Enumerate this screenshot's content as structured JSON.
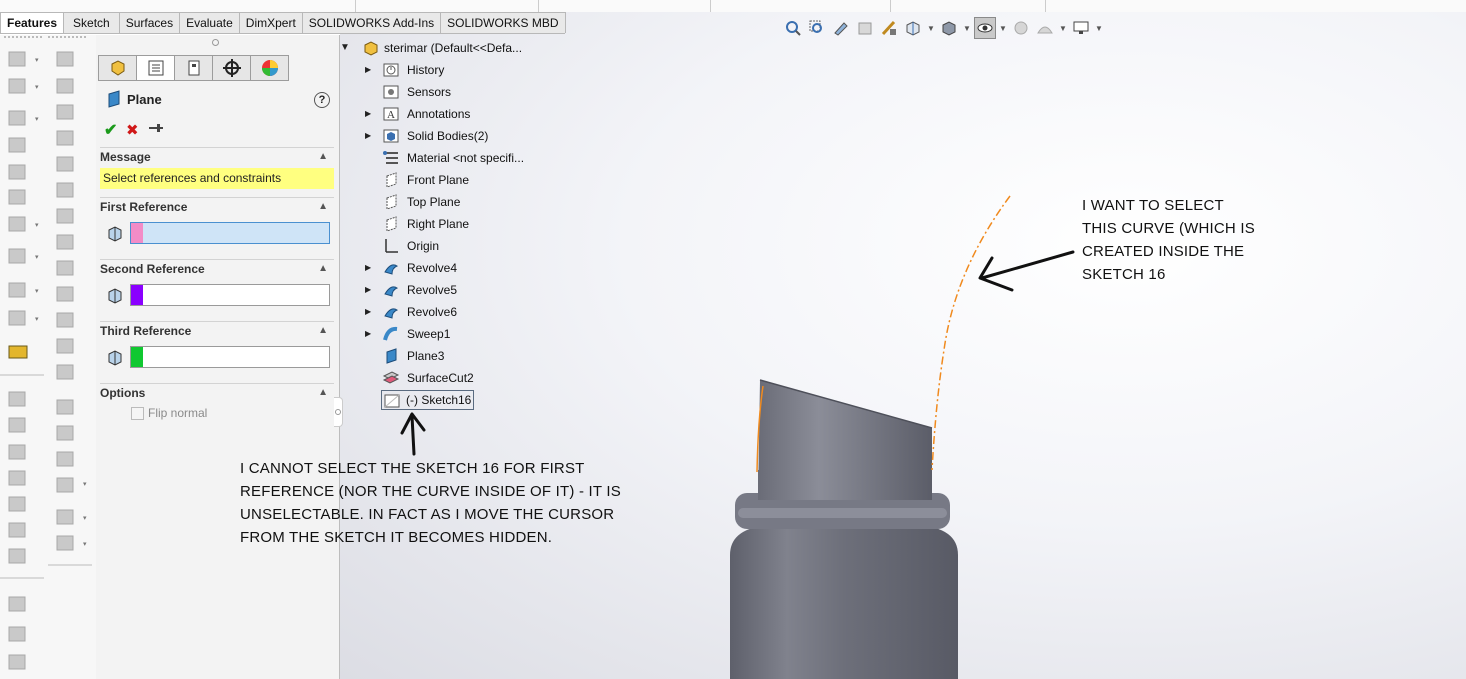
{
  "command_tabs": [
    "Features",
    "Sketch",
    "Surfaces",
    "Evaluate",
    "DimXpert",
    "SOLIDWORKS Add-Ins",
    "SOLIDWORKS MBD"
  ],
  "property_manager": {
    "title": "Plane",
    "help_icon": "?",
    "ok_icon": "✔",
    "cancel_icon": "✖",
    "pin_icon": "pin-icon",
    "message_header": "Message",
    "message_text": "Select references and constraints",
    "first_reference_header": "First Reference",
    "second_reference_header": "Second Reference",
    "third_reference_header": "Third Reference",
    "options_header": "Options",
    "flip_normal_label": "Flip normal",
    "colors": {
      "first": "#f38cc7",
      "second": "#8a00ff",
      "third": "#10c830",
      "message_bg": "#ffff80",
      "first_field_bg": "#cfe4f7"
    }
  },
  "feature_tree": {
    "root": "sterimar  (Default<<Defa...",
    "items": [
      {
        "label": "History",
        "icon": "history-icon",
        "expandable": true
      },
      {
        "label": "Sensors",
        "icon": "sensor-icon",
        "expandable": false
      },
      {
        "label": "Annotations",
        "icon": "annotation-icon",
        "expandable": true
      },
      {
        "label": "Solid Bodies(2)",
        "icon": "solid-bodies-icon",
        "expandable": true
      },
      {
        "label": "Material <not specifi...",
        "icon": "material-icon",
        "expandable": false
      },
      {
        "label": "Front Plane",
        "icon": "plane-icon",
        "expandable": false
      },
      {
        "label": "Top Plane",
        "icon": "plane-icon",
        "expandable": false
      },
      {
        "label": "Right Plane",
        "icon": "plane-icon",
        "expandable": false
      },
      {
        "label": "Origin",
        "icon": "origin-icon",
        "expandable": false
      },
      {
        "label": "Revolve4",
        "icon": "revolve-icon",
        "expandable": true
      },
      {
        "label": "Revolve5",
        "icon": "revolve-icon",
        "expandable": true
      },
      {
        "label": "Revolve6",
        "icon": "revolve-icon",
        "expandable": true
      },
      {
        "label": "Sweep1",
        "icon": "sweep-icon",
        "expandable": true
      },
      {
        "label": "Plane3",
        "icon": "plane3-icon",
        "expandable": false
      },
      {
        "label": "SurfaceCut2",
        "icon": "surface-cut-icon",
        "expandable": false
      },
      {
        "label": "(-) Sketch16",
        "icon": "sketch-icon",
        "expandable": false
      }
    ]
  },
  "annotations": {
    "left_note": [
      "I CANNOT SELECT THE SKETCH 16 FOR FIRST",
      "REFERENCE (NOR THE CURVE INSIDE OF IT) - IT IS",
      "UNSELECTABLE. IN FACT AS I MOVE THE CURSOR",
      "FROM THE SKETCH IT BECOMES HIDDEN."
    ],
    "right_note": [
      "I WANT TO SELECT",
      "THIS CURVE (WHICH IS",
      "CREATED INSIDE THE",
      "SKETCH 16"
    ]
  },
  "model_colors": {
    "body": "#6b6d78",
    "highlight": "#9a9ca6",
    "curve": "#f08a1e"
  }
}
